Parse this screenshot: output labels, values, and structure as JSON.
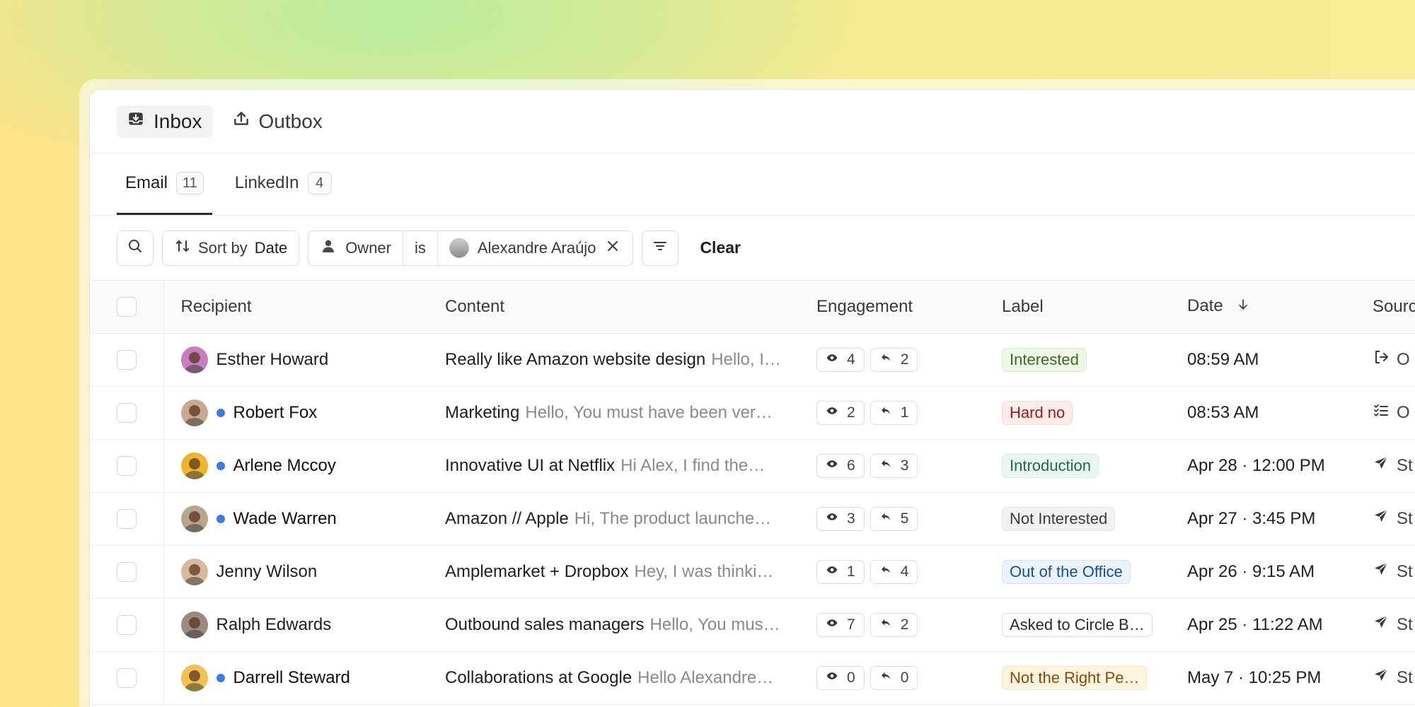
{
  "topnav": [
    {
      "label": "Inbox",
      "icon": "inbox-icon",
      "active": true
    },
    {
      "label": "Outbox",
      "icon": "upload-icon",
      "active": false
    }
  ],
  "tabs": [
    {
      "label": "Email",
      "count": "11",
      "active": true
    },
    {
      "label": "LinkedIn",
      "count": "4",
      "active": false
    }
  ],
  "filters": {
    "sort_prefix": "Sort by",
    "sort_value": "Date",
    "owner_field": "Owner",
    "owner_operator": "is",
    "owner_value": "Alexandre Araújo",
    "clear_label": "Clear"
  },
  "columns": {
    "recipient": "Recipient",
    "content": "Content",
    "engagement": "Engagement",
    "label": "Label",
    "date": "Date",
    "source": "Sourc"
  },
  "rows": [
    {
      "name": "Esther Howard",
      "unread": false,
      "avatar_color": "#c77dbf",
      "subject": "Really like Amazon website design",
      "preview": "Hello, I…",
      "opens": "4",
      "replies": "2",
      "label": "Interested",
      "label_bg": "#eef8e6",
      "label_fg": "#3d6b1e",
      "label_border": "#dcefcc",
      "date": "08:59 AM",
      "source_icon": "sign-out-icon",
      "source": "O"
    },
    {
      "name": "Robert Fox",
      "unread": true,
      "avatar_color": "#c9a991",
      "subject": "Marketing",
      "preview": "Hello, You must have been ver…",
      "opens": "2",
      "replies": "1",
      "label": "Hard no",
      "label_bg": "#fdecec",
      "label_fg": "#a11a1a",
      "label_border": "#f7d6d6",
      "date": "08:53 AM",
      "source_icon": "checklist-icon",
      "source": "O"
    },
    {
      "name": "Arlene Mccoy",
      "unread": true,
      "avatar_color": "#f0b429",
      "subject": "Innovative UI at Netflix",
      "preview": "Hi Alex, I find the…",
      "opens": "6",
      "replies": "3",
      "label": "Introduction",
      "label_bg": "#eaf7f1",
      "label_fg": "#1f6b52",
      "label_border": "#d3eee2",
      "date": "Apr 28 · 12:00 PM",
      "source_icon": "send-icon",
      "source": "St"
    },
    {
      "name": "Wade Warren",
      "unread": true,
      "avatar_color": "#b9a58e",
      "subject": "Amazon // Apple",
      "preview": "Hi, The product launche…",
      "opens": "3",
      "replies": "5",
      "label": "Not Interested",
      "label_bg": "#f2f2f2",
      "label_fg": "#3a3a3a",
      "label_border": "#e3e3e3",
      "date": "Apr 27 · 3:45 PM",
      "source_icon": "send-icon",
      "source": "St"
    },
    {
      "name": "Jenny Wilson",
      "unread": false,
      "avatar_color": "#d9b99b",
      "subject": "Amplemarket + Dropbox",
      "preview": "Hey, I was thinki…",
      "opens": "1",
      "replies": "4",
      "label": "Out of the Office",
      "label_bg": "#e9f2fd",
      "label_fg": "#1d4f91",
      "label_border": "#d2e4f9",
      "date": "Apr 26 · 9:15 AM",
      "source_icon": "send-icon",
      "source": "St"
    },
    {
      "name": "Ralph Edwards",
      "unread": false,
      "avatar_color": "#9c8a80",
      "subject": "Outbound sales managers",
      "preview": "Hello, You mus…",
      "opens": "7",
      "replies": "2",
      "label": "Asked to Circle B…",
      "label_bg": "#ffffff",
      "label_fg": "#2a2a2a",
      "label_border": "#dedede",
      "date": "Apr 25 · 11:22 AM",
      "source_icon": "send-icon",
      "source": "St"
    },
    {
      "name": "Darrell Steward",
      "unread": true,
      "avatar_color": "#f2c14e",
      "subject": "Collaborations at Google",
      "preview": "Hello Alexandre…",
      "opens": "0",
      "replies": "0",
      "label": "Not the Right Pe…",
      "label_bg": "#fff4e0",
      "label_fg": "#8a4a06",
      "label_border": "#fbe6c0",
      "date": "May 7 · 10:25 PM",
      "source_icon": "send-icon",
      "source": "St"
    }
  ]
}
